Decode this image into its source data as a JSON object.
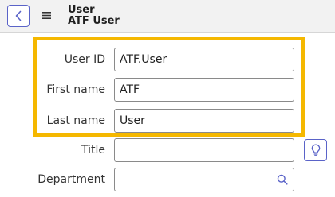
{
  "header": {
    "title": "User",
    "subtitle": "ATF User"
  },
  "form": {
    "user_id": {
      "label": "User ID",
      "value": "ATF.User"
    },
    "first_name": {
      "label": "First name",
      "value": "ATF"
    },
    "last_name": {
      "label": "Last name",
      "value": "User"
    },
    "title": {
      "label": "Title",
      "value": ""
    },
    "department": {
      "label": "Department",
      "value": ""
    }
  },
  "icons": {
    "back": "chevron-left-icon",
    "menu": "hamburger-menu-icon",
    "suggestion": "lightbulb-icon",
    "lookup": "search-icon"
  },
  "colors": {
    "highlight": "#f5b800",
    "accent": "#5a63c8",
    "header_bg": "#f2f2f2"
  }
}
